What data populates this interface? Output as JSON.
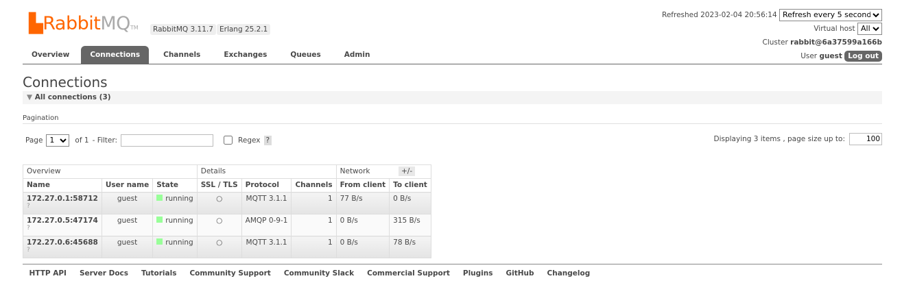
{
  "header": {
    "logo_brand": "Rabbit",
    "logo_mq": "MQ",
    "logo_tm": "TM",
    "rabbitmq_version": "RabbitMQ 3.11.7",
    "erlang_version": "Erlang 25.2.1"
  },
  "nav": {
    "tabs": [
      {
        "label": "Overview"
      },
      {
        "label": "Connections",
        "active": true
      },
      {
        "label": "Channels"
      },
      {
        "label": "Exchanges"
      },
      {
        "label": "Queues"
      },
      {
        "label": "Admin"
      }
    ]
  },
  "status": {
    "refreshed": "Refreshed 2023-02-04 20:56:14",
    "refresh_option": "Refresh every 5 seconds",
    "vhost_label": "Virtual host",
    "vhost_value": "All",
    "cluster_label": "Cluster",
    "cluster_name": "rabbit@6a37599a166b",
    "user_label": "User",
    "user_name": "guest",
    "logout": "Log out"
  },
  "page": {
    "title": "Connections",
    "section": "All connections (3)"
  },
  "pagination": {
    "label": "Pagination",
    "page_label": "Page",
    "page_value": "1",
    "of": "of 1",
    "filter_label": "- Filter:",
    "filter_value": "",
    "regex_label": "Regex",
    "help": "?",
    "displaying": "Displaying 3 items , page size up to:",
    "page_size": "100"
  },
  "table": {
    "groups": [
      "Overview",
      "Details",
      "Network"
    ],
    "toggle": "+/-",
    "columns": [
      "Name",
      "User name",
      "State",
      "SSL / TLS",
      "Protocol",
      "Channels",
      "From client",
      "To client"
    ],
    "rows": [
      {
        "name": "172.27.0.1:58712",
        "q": "?",
        "user": "guest",
        "state": "running",
        "ssl": "○",
        "protocol": "MQTT 3.1.1",
        "channels": "1",
        "from": "77 B/s",
        "to": "0 B/s"
      },
      {
        "name": "172.27.0.5:47174",
        "q": "?",
        "user": "guest",
        "state": "running",
        "ssl": "○",
        "protocol": "AMQP 0-9-1",
        "channels": "1",
        "from": "0 B/s",
        "to": "315 B/s"
      },
      {
        "name": "172.27.0.6:45688",
        "q": "?",
        "user": "guest",
        "state": "running",
        "ssl": "○",
        "protocol": "MQTT 3.1.1",
        "channels": "1",
        "from": "0 B/s",
        "to": "78 B/s"
      }
    ]
  },
  "footer": {
    "links": [
      "HTTP API",
      "Server Docs",
      "Tutorials",
      "Community Support",
      "Community Slack",
      "Commercial Support",
      "Plugins",
      "GitHub",
      "Changelog"
    ]
  }
}
